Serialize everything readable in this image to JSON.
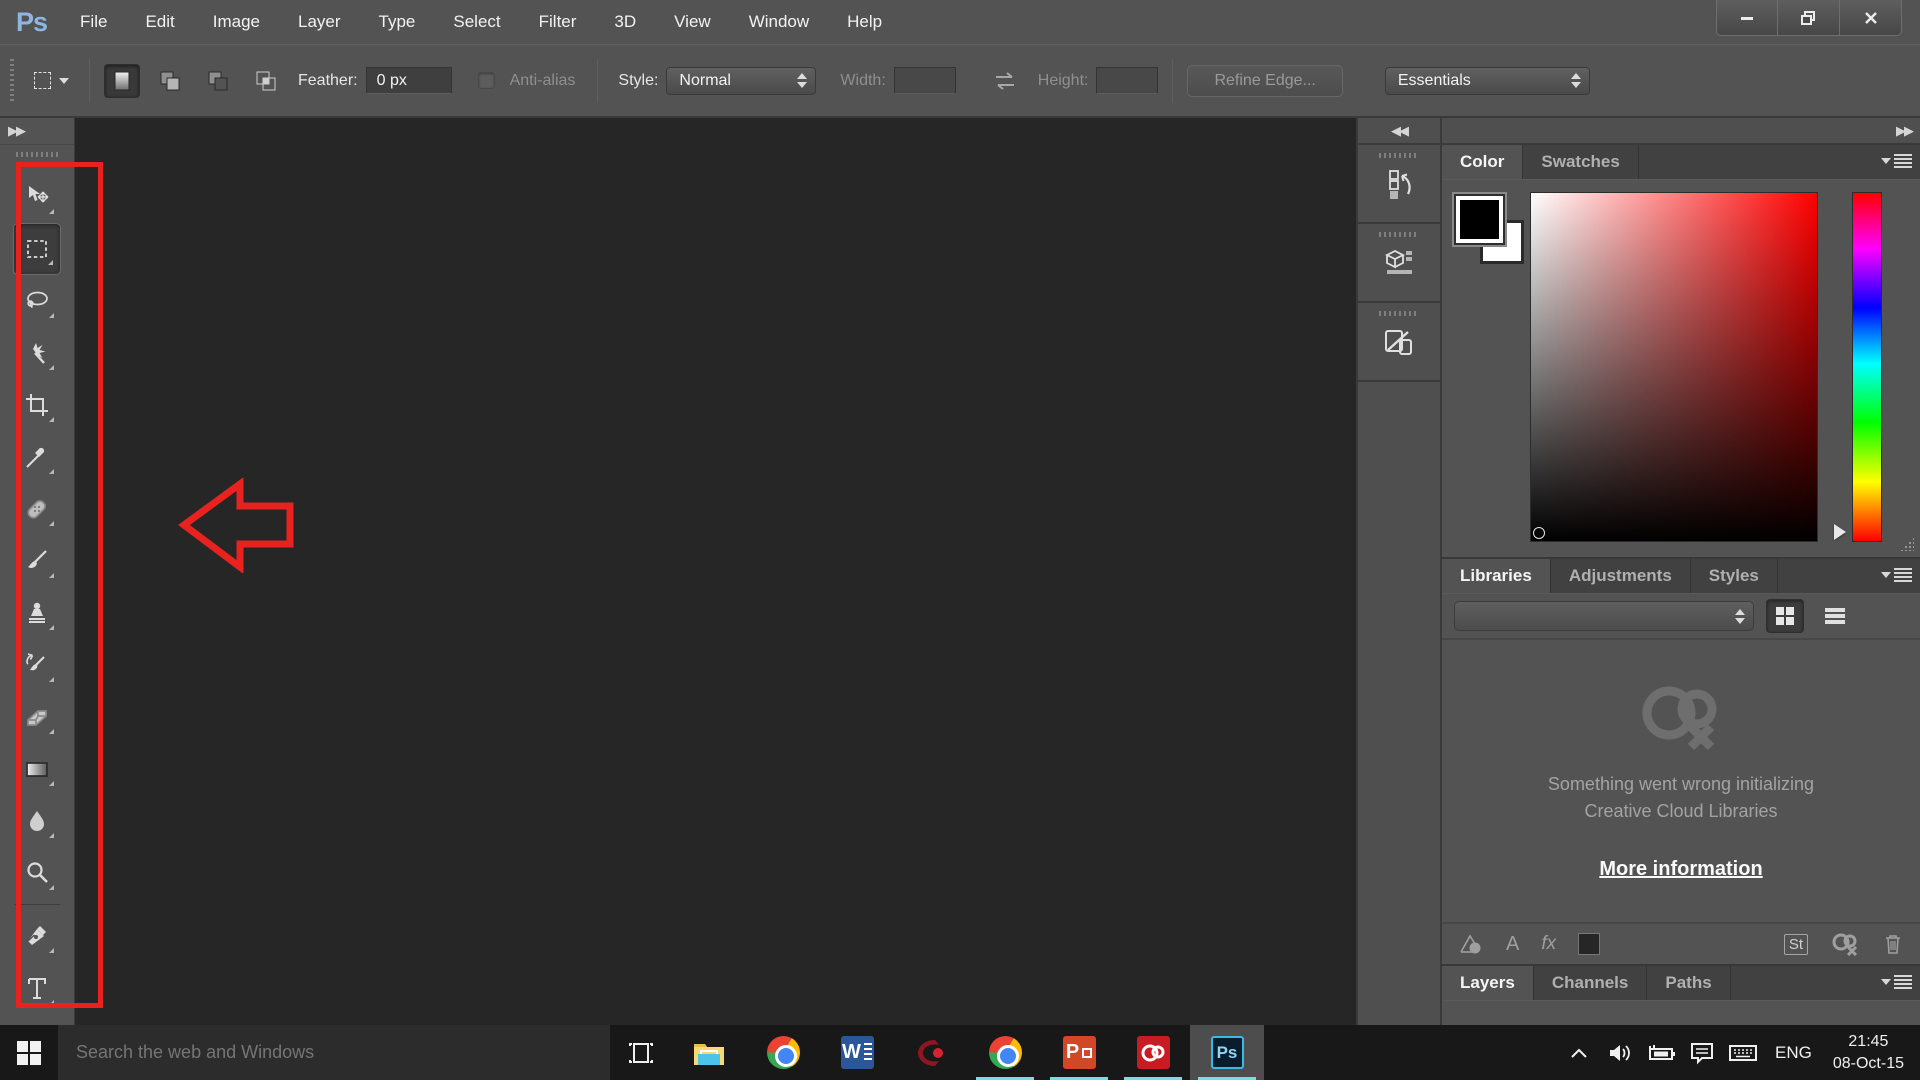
{
  "titlebar": {
    "logo": "Ps",
    "menus": [
      "File",
      "Edit",
      "Image",
      "Layer",
      "Type",
      "Select",
      "Filter",
      "3D",
      "View",
      "Window",
      "Help"
    ]
  },
  "options_bar": {
    "feather_label": "Feather:",
    "feather_value": "0 px",
    "anti_alias_label": "Anti-alias",
    "style_label": "Style:",
    "style_value": "Normal",
    "width_label": "Width:",
    "height_label": "Height:",
    "refine_edge_label": "Refine Edge...",
    "workspace_value": "Essentials"
  },
  "tool_dock": {
    "tools": [
      "move",
      "rectangular-marquee",
      "lasso",
      "magic-wand",
      "crop",
      "eyedropper",
      "spot-healing",
      "brush",
      "clone-stamp",
      "history-brush",
      "eraser",
      "gradient",
      "blur",
      "zoom",
      "pen",
      "type"
    ],
    "selected_tool": "rectangular-marquee"
  },
  "icon_dock": {
    "buttons": [
      "history-panel",
      "3d-panel",
      "device-preview-panel"
    ]
  },
  "panels": {
    "color": {
      "tabs": [
        "Color",
        "Swatches"
      ],
      "active_tab": "Color",
      "foreground_color": "#000000",
      "background_color": "#ffffff"
    },
    "libraries": {
      "tabs": [
        "Libraries",
        "Adjustments",
        "Styles"
      ],
      "active_tab": "Libraries",
      "combo_value": "",
      "error_line1": "Something went wrong initializing",
      "error_line2": "Creative Cloud Libraries",
      "link_label": "More information",
      "footer": {
        "type_label": "A",
        "fx_label": "fx",
        "st_label": "St"
      }
    },
    "layers": {
      "tabs": [
        "Layers",
        "Channels",
        "Paths"
      ],
      "active_tab": "Layers"
    }
  },
  "taskbar": {
    "search_placeholder": "Search the web and Windows",
    "apps": [
      "task-view",
      "file-explorer",
      "chrome",
      "word",
      "red-app",
      "chrome-2",
      "powerpoint",
      "creative-cloud",
      "photoshop"
    ],
    "running_apps": [
      "chrome-2",
      "powerpoint",
      "creative-cloud",
      "photoshop"
    ],
    "active_app": "photoshop",
    "word_glyph": "W",
    "powerpoint_glyph": "P",
    "photoshop_glyph": "Ps",
    "tray": {
      "language": "ENG",
      "time": "21:45",
      "date": "08-Oct-15"
    }
  },
  "annotations": {
    "color": "#e8231f",
    "shapes": [
      "rectangle-around-toolbar",
      "arrow-pointing-left-at-toolbar"
    ]
  },
  "colors": {
    "chrome_bg": "#535353",
    "canvas_bg": "#262626",
    "taskbar_bg": "#181818",
    "running_indicator": "#76dde0"
  }
}
